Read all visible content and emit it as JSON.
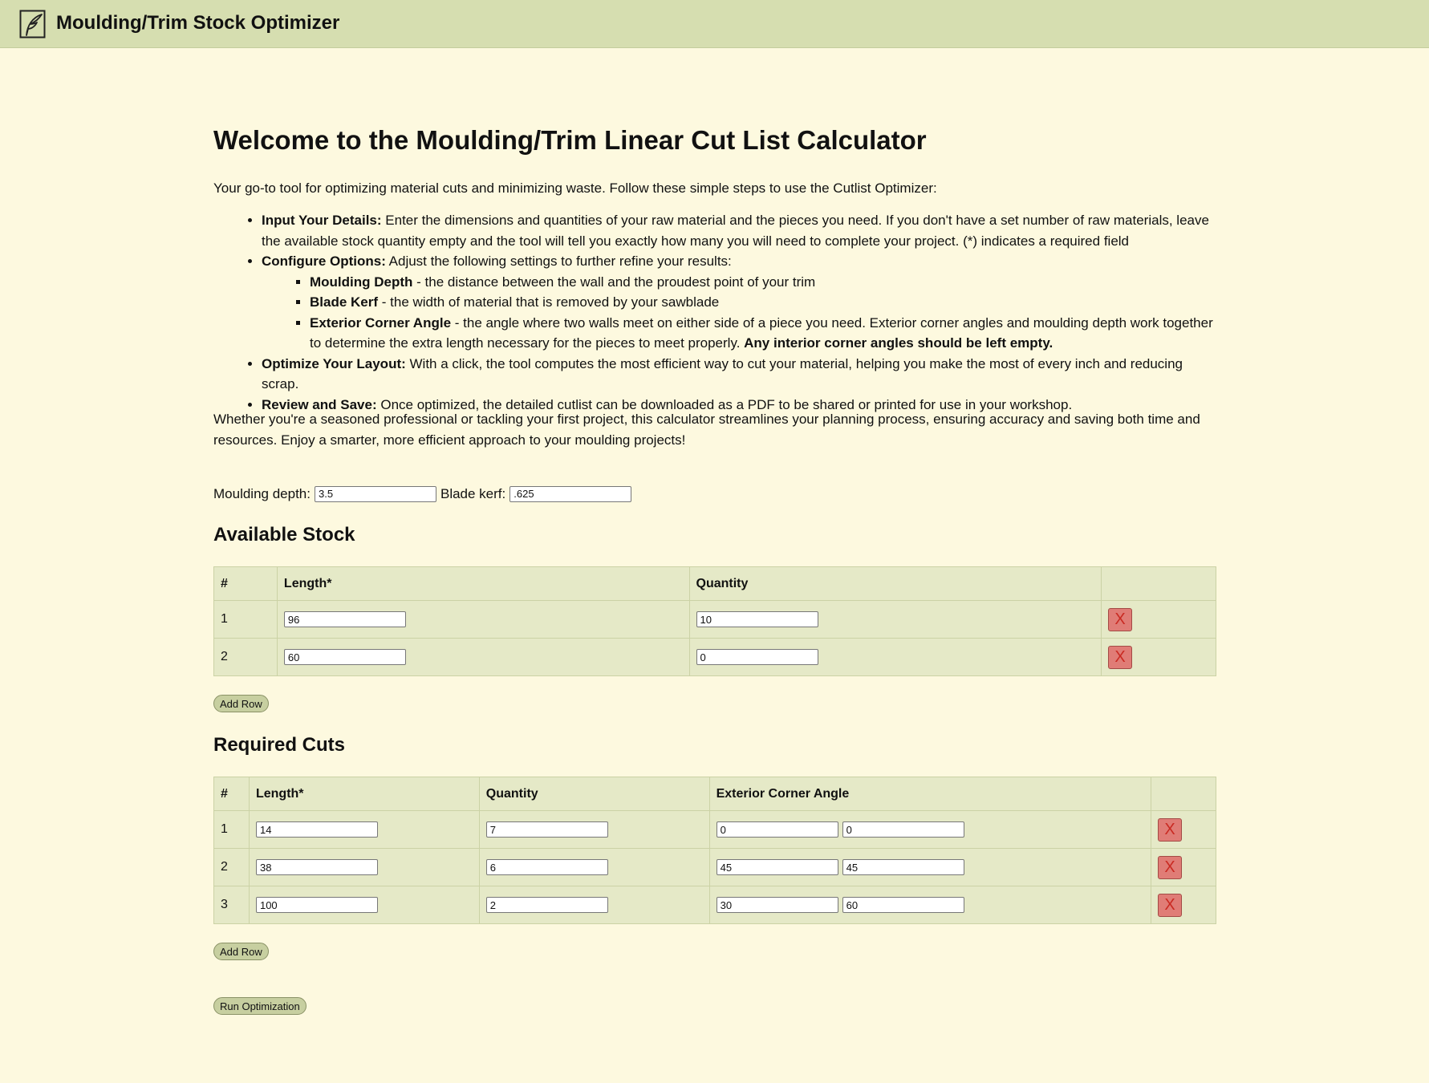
{
  "header": {
    "title": "Moulding/Trim Stock Optimizer",
    "logo_icon": "feather-logo-icon"
  },
  "welcome": {
    "heading": "Welcome to the Moulding/Trim Linear Cut List Calculator",
    "intro": "Your go-to tool for optimizing material cuts and minimizing waste. Follow these simple steps to use the Cutlist Optimizer:",
    "steps": [
      {
        "title": "Input Your Details:",
        "text": " Enter the dimensions and quantities of your raw material and the pieces you need. If you don't have a set number of raw materials, leave the available stock quantity empty and the tool will tell you exactly how many you will need to complete your project. (*) indicates a required field"
      },
      {
        "title": "Configure Options:",
        "text": " Adjust the following settings to further refine your results:"
      },
      {
        "title": "Optimize Your Layout:",
        "text": " With a click, the tool computes the most efficient way to cut your material, helping you make the most of every inch and reducing scrap."
      },
      {
        "title": "Review and Save:",
        "text": " Once optimized, the detailed cutlist can be downloaded as a PDF to be shared or printed for use in your workshop."
      }
    ],
    "options_help": [
      {
        "title": "Moulding Depth",
        "text": " - the distance between the wall and the proudest point of your trim"
      },
      {
        "title": "Blade Kerf",
        "text": " - the width of material that is removed by your sawblade"
      },
      {
        "title": "Exterior Corner Angle",
        "text": " - the angle where two walls meet on either side of a piece you need. Exterior corner angles and moulding depth work together to determine the extra length necessary for the pieces to meet properly. ",
        "emphasis": "Any interior corner angles should be left empty."
      }
    ],
    "outro": "Whether you're a seasoned professional or tackling your first project, this calculator streamlines your planning process, ensuring accuracy and saving both time and resources. Enjoy a smarter, more efficient approach to your moulding projects!"
  },
  "options": {
    "depth_label": "Moulding depth:",
    "depth_value": "3.5",
    "kerf_label": "Blade kerf:",
    "kerf_value": ".625"
  },
  "stock": {
    "heading": "Available Stock",
    "columns": [
      "#",
      "Length*",
      "Quantity",
      ""
    ],
    "rows": [
      {
        "num": "1",
        "length": "96",
        "quantity": "10"
      },
      {
        "num": "2",
        "length": "60",
        "quantity": "0"
      }
    ],
    "delete_label": "X",
    "add_label": "Add Row"
  },
  "cuts": {
    "heading": "Required Cuts",
    "columns": [
      "#",
      "Length*",
      "Quantity",
      "Exterior Corner Angle",
      ""
    ],
    "rows": [
      {
        "num": "1",
        "length": "14",
        "quantity": "7",
        "angle_a": "0",
        "angle_b": "0"
      },
      {
        "num": "2",
        "length": "38",
        "quantity": "6",
        "angle_a": "45",
        "angle_b": "45"
      },
      {
        "num": "3",
        "length": "100",
        "quantity": "2",
        "angle_a": "30",
        "angle_b": "60"
      }
    ],
    "delete_label": "X",
    "add_label": "Add Row"
  },
  "run_label": "Run Optimization",
  "colors": {
    "page_bg": "#fdf9df",
    "header_bg": "#d6deb0",
    "table_bg": "#e5e9c7",
    "delete_bg": "#e07c76",
    "button_bg": "#c7cfa0"
  }
}
